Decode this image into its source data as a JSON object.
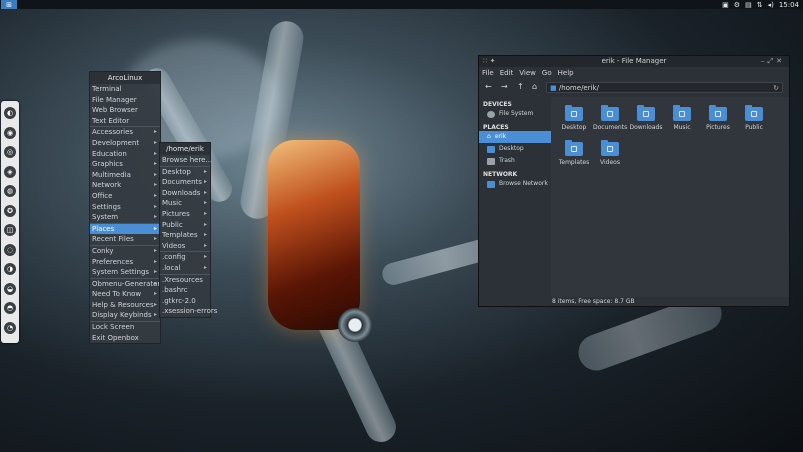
{
  "topbar": {
    "logo": "⊞",
    "time": "15:04",
    "tray_icons": [
      "camera-icon",
      "gear-icon",
      "clipboard-icon",
      "network-icon",
      "volume-icon"
    ]
  },
  "dock": {
    "items": [
      "app-icon",
      "app-icon",
      "app-icon",
      "app-icon",
      "app-icon",
      "app-icon",
      "app-icon",
      "app-icon",
      "app-icon",
      "app-icon",
      "app-icon",
      "app-icon"
    ]
  },
  "menu": {
    "title": "ArcoLinux",
    "items": [
      {
        "label": "Terminal"
      },
      {
        "label": "File Manager"
      },
      {
        "label": "Web Browser"
      },
      {
        "label": "Text Editor"
      },
      {
        "label": "Accessories",
        "sub": true
      },
      {
        "label": "Development",
        "sub": true
      },
      {
        "label": "Education",
        "sub": true
      },
      {
        "label": "Graphics",
        "sub": true
      },
      {
        "label": "Multimedia",
        "sub": true
      },
      {
        "label": "Network",
        "sub": true
      },
      {
        "label": "Office",
        "sub": true
      },
      {
        "label": "Settings",
        "sub": true
      },
      {
        "label": "System",
        "sub": true
      },
      {
        "label": "Places",
        "sub": true
      },
      {
        "label": "Recent Files",
        "sub": true
      },
      {
        "label": "Conky",
        "sub": true
      },
      {
        "label": "Preferences",
        "sub": true
      },
      {
        "label": "System Settings",
        "sub": true
      },
      {
        "label": "Obmenu-Generator",
        "sub": true
      },
      {
        "label": "Need To Know",
        "sub": true
      },
      {
        "label": "Help & Resources",
        "sub": true
      },
      {
        "label": "Display Keybinds",
        "sub": true
      },
      {
        "label": "Lock Screen"
      },
      {
        "label": "Exit Openbox"
      }
    ]
  },
  "submenu": {
    "title": "/home/erik",
    "items": [
      {
        "label": "Browse here..."
      },
      {
        "label": "Desktop",
        "sub": true
      },
      {
        "label": "Documents",
        "sub": true
      },
      {
        "label": "Downloads",
        "sub": true
      },
      {
        "label": "Music",
        "sub": true
      },
      {
        "label": "Pictures",
        "sub": true
      },
      {
        "label": "Public",
        "sub": true
      },
      {
        "label": "Templates",
        "sub": true
      },
      {
        "label": "Videos",
        "sub": true
      },
      {
        "label": ".config",
        "sub": true
      },
      {
        "label": ".local",
        "sub": true
      },
      {
        "label": ".Xresources"
      },
      {
        "label": ".bashrc"
      },
      {
        "label": ".gtkrc-2.0"
      },
      {
        "label": ".xsession-errors"
      }
    ]
  },
  "filemanager": {
    "title": "erik - File Manager",
    "menubar": [
      "File",
      "Edit",
      "View",
      "Go",
      "Help"
    ],
    "path": "/home/erik/",
    "sidebar": {
      "devices_header": "DEVICES",
      "devices": [
        "File System"
      ],
      "places_header": "PLACES",
      "places": [
        "erik",
        "Desktop",
        "Trash"
      ],
      "network_header": "NETWORK",
      "network": [
        "Browse Network"
      ]
    },
    "folders": [
      "Desktop",
      "Documents",
      "Downloads",
      "Music",
      "Pictures",
      "Public",
      "Templates",
      "Videos"
    ],
    "status": "8 items, Free space: 8.7 GB"
  }
}
